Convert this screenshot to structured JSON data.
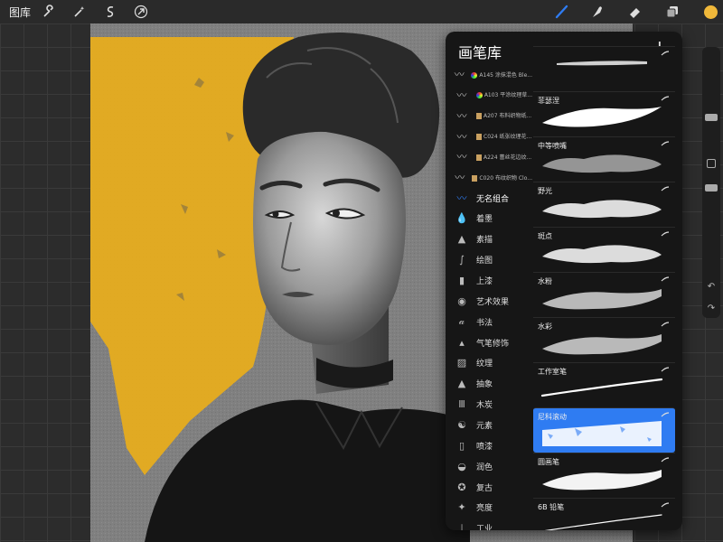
{
  "topbar": {
    "gallery_label": "图库",
    "left_icons": [
      "wrench-icon",
      "magic-wand-icon",
      "selection-s-icon",
      "arrow-cursor-icon"
    ],
    "right_icons": [
      "brush-icon",
      "smudge-icon",
      "eraser-icon",
      "layers-icon",
      "color-swatch"
    ],
    "accent": "#2f7cf2",
    "current_color": "#f0b83a"
  },
  "panel": {
    "title": "画笔库",
    "add_label": "+",
    "categories": [
      {
        "label": "A145 涂抹混色 Ble...",
        "icon": "rainbow-brush-icon",
        "small": true,
        "book": false,
        "rainbow": true
      },
      {
        "label": "A103 平涂纹理草...",
        "icon": "rainbow-brush-icon",
        "small": true,
        "book": false,
        "rainbow": true
      },
      {
        "label": "A207 布料织物纸...",
        "icon": "book-brush-icon",
        "small": true,
        "book": true
      },
      {
        "label": "C024 纸张纹理花...",
        "icon": "book-brush-icon",
        "small": true,
        "book": true
      },
      {
        "label": "A224 蕾丝花边纹...",
        "icon": "book-brush-icon",
        "small": true,
        "book": true
      },
      {
        "label": "C020 布纹织物 Clo...",
        "icon": "book-brush-icon",
        "small": true,
        "book": true
      },
      {
        "label": "无名组合",
        "icon": "blue-brush-icon",
        "small": false,
        "active": true
      },
      {
        "label": "着墨",
        "icon": "ink-drop-icon"
      },
      {
        "label": "素描",
        "icon": "pencil-tip-icon"
      },
      {
        "label": "绘图",
        "icon": "squiggle-icon"
      },
      {
        "label": "上漆",
        "icon": "paint-brush-icon"
      },
      {
        "label": "艺术效果",
        "icon": "palette-icon"
      },
      {
        "label": "书法",
        "icon": "calligraphy-icon"
      },
      {
        "label": "气笔修饰",
        "icon": "airbrush-icon"
      },
      {
        "label": "纹理",
        "icon": "texture-icon"
      },
      {
        "label": "抽象",
        "icon": "triangle-icon"
      },
      {
        "label": "木炭",
        "icon": "charcoal-icon"
      },
      {
        "label": "元素",
        "icon": "yin-yang-icon"
      },
      {
        "label": "喷漆",
        "icon": "spray-can-icon"
      },
      {
        "label": "润色",
        "icon": "touchup-icon"
      },
      {
        "label": "复古",
        "icon": "retro-star-icon"
      },
      {
        "label": "亮度",
        "icon": "sparkle-icon"
      },
      {
        "label": "工业",
        "icon": "anvil-icon"
      }
    ],
    "brushes": [
      {
        "name": "",
        "style": "partial"
      },
      {
        "name": "菲瑟涅",
        "style": "textured"
      },
      {
        "name": "中等喷嘴",
        "style": "spray"
      },
      {
        "name": "野光",
        "style": "cloud"
      },
      {
        "name": "斑点",
        "style": "cloud"
      },
      {
        "name": "水粉",
        "style": "soft"
      },
      {
        "name": "水彩",
        "style": "soft"
      },
      {
        "name": "工作室笔",
        "style": "thin"
      },
      {
        "name": "尼科滚动",
        "style": "roller",
        "selected": true
      },
      {
        "name": "圆画笔",
        "style": "round"
      },
      {
        "name": "6B 铅笔",
        "style": "pencil"
      }
    ]
  }
}
